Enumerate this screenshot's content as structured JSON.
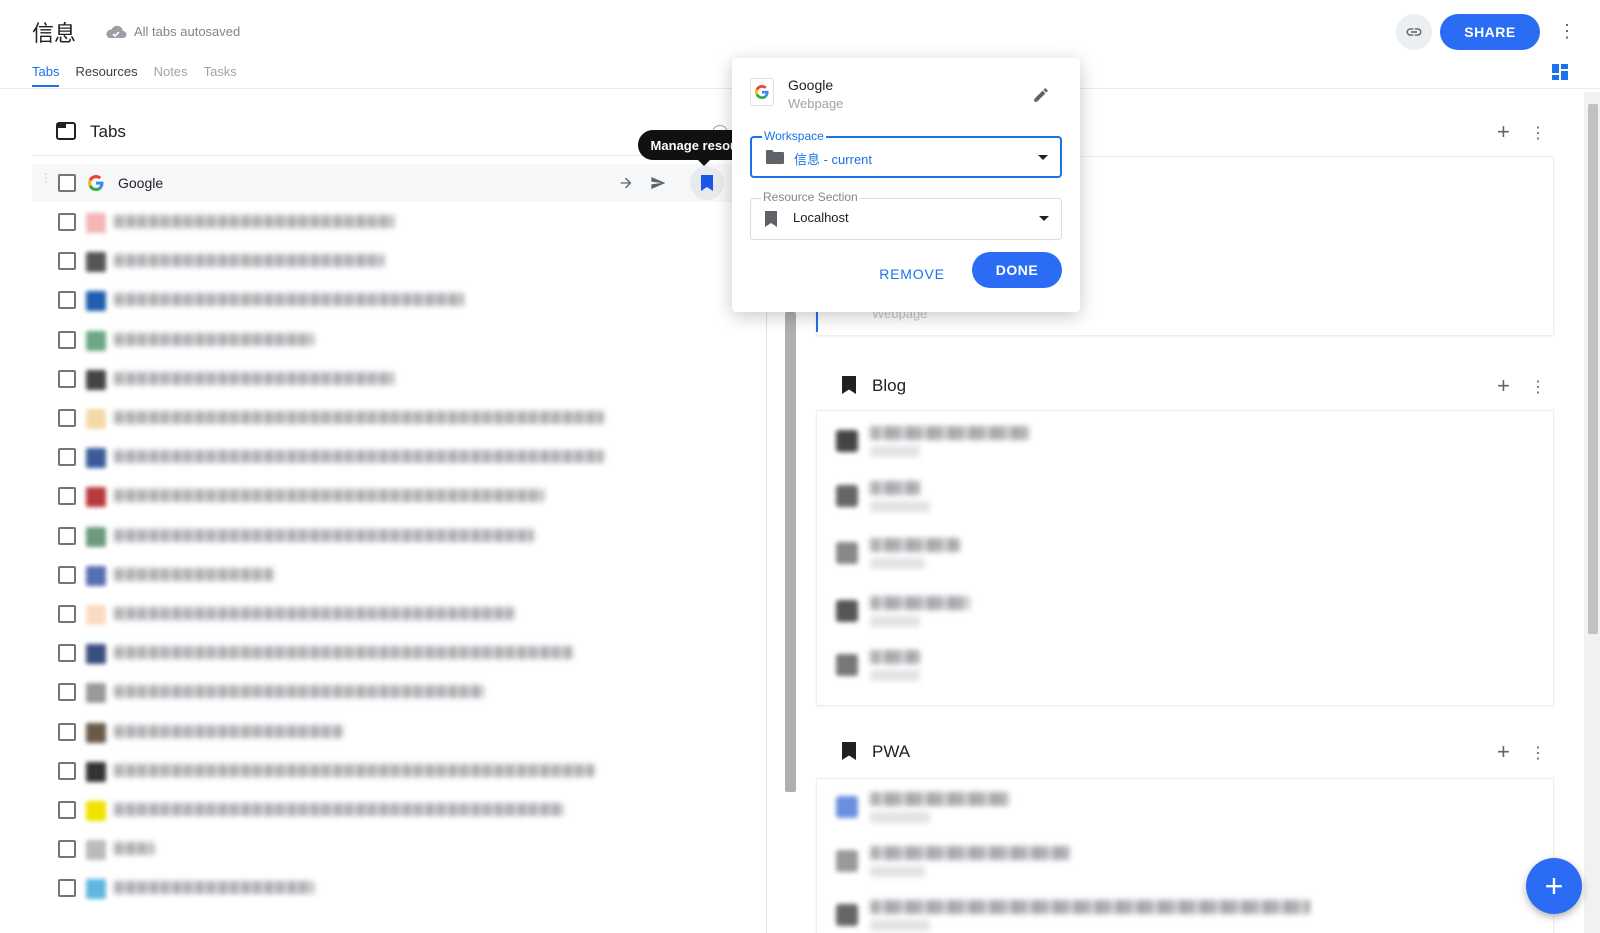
{
  "header": {
    "workspace_title": "信息",
    "autosave_status": "All tabs autosaved",
    "share_label": "SHARE",
    "nav": [
      {
        "label": "Tabs",
        "state": "active"
      },
      {
        "label": "Resources",
        "state": "normal"
      },
      {
        "label": "Notes",
        "state": "disabled"
      },
      {
        "label": "Tasks",
        "state": "disabled"
      }
    ]
  },
  "tabs_panel": {
    "title": "Tabs",
    "tooltip": "Manage resource",
    "first_row": {
      "title": "Google"
    },
    "blurred_row_count": 18
  },
  "right_panel": {
    "sections": [
      {
        "title": "Blog"
      },
      {
        "title": "PWA"
      }
    ],
    "ghost_subtitle": "Webpage"
  },
  "popup": {
    "resource_title": "Google",
    "resource_type": "Webpage",
    "workspace_label": "Workspace",
    "workspace_value": "信息 - current",
    "section_label": "Resource Section",
    "section_value": "Localhost",
    "remove_label": "REMOVE",
    "done_label": "DONE"
  },
  "colors": {
    "accent": "#2a6df4",
    "link": "#1a73e8"
  },
  "icons": {
    "cloud": "cloud-icon",
    "link": "link-icon",
    "more": "more-vert-icon",
    "layout": "dashboard-icon",
    "tabs": "tab-window-icon",
    "bookmark": "bookmark-icon",
    "edit": "pencil-icon",
    "folder": "folder-icon",
    "add": "plus-icon"
  }
}
